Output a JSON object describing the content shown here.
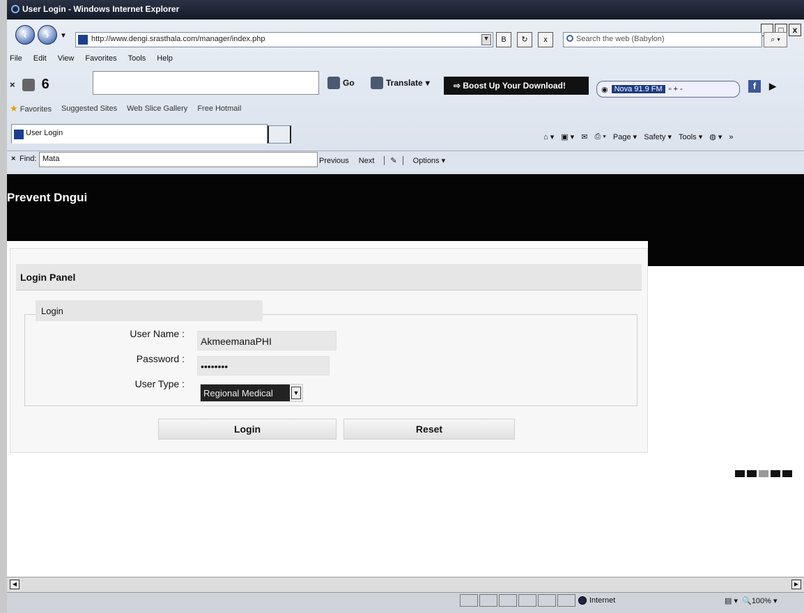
{
  "window": {
    "title": "User Login - Windows Internet Explorer"
  },
  "address": {
    "url": "http://www.dengi.srasthala.com/manager/index.php"
  },
  "search": {
    "placeholder": "Search the web (Babylon)"
  },
  "menu": [
    "File",
    "Edit",
    "View",
    "Favorites",
    "Tools",
    "Help"
  ],
  "toolbar": {
    "go": "Go",
    "translate": "Translate",
    "boost": "Boost Up Your Download!",
    "radio": "Nova 91.9 FM"
  },
  "favorites": {
    "label": "Favorites",
    "items": [
      "Suggested Sites",
      "Web Slice Gallery",
      "Free Hotmail"
    ]
  },
  "tab": {
    "label": "User Login"
  },
  "commandbar": {
    "page": "Page",
    "safety": "Safety",
    "tools": "Tools"
  },
  "find": {
    "label": "Find:",
    "value": "Mata",
    "previous": "Previous",
    "next": "Next",
    "options": "Options"
  },
  "site": {
    "title": "Prevent Dngui"
  },
  "login": {
    "panel_title": "Login Panel",
    "legend": "Login",
    "username_label": "User Name :",
    "username_value": "AkmeemanaPHI",
    "password_label": "Password :",
    "password_value": "••••••••",
    "usertype_label": "User Type :",
    "usertype_value": "Regional Medical",
    "login_button": "Login",
    "reset_button": "Reset"
  },
  "status": {
    "zone": "Internet",
    "zoom": "100%"
  }
}
